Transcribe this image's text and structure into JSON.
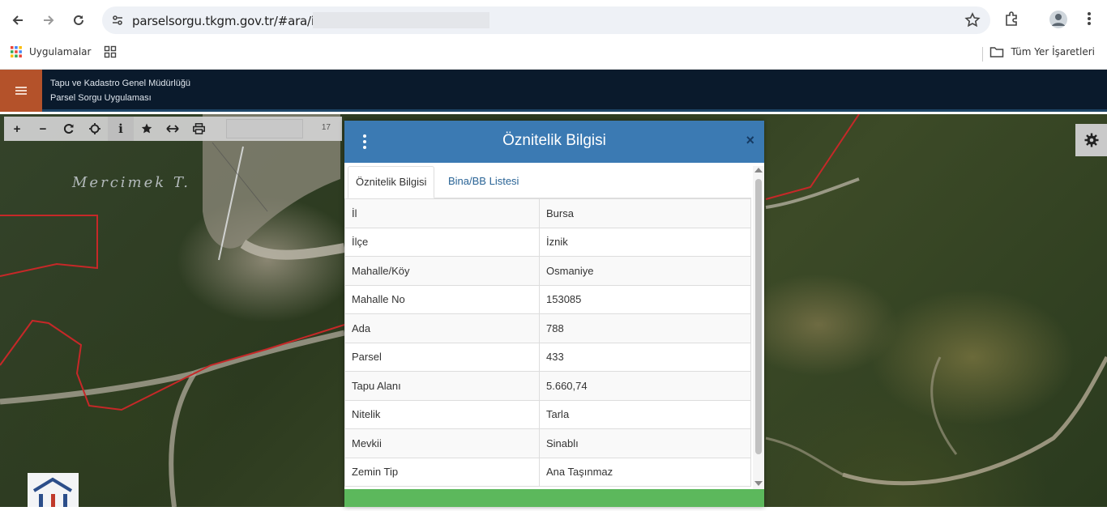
{
  "browser": {
    "url": "parselsorgu.tkgm.gov.tr/#ara/idari/",
    "bookmarks_apps_label": "Uygulamalar",
    "bookmarks_all_label": "Tüm Yer İşaretleri"
  },
  "app": {
    "org_title": "Tapu ve Kadastro Genel Müdürlüğü",
    "app_title": "Parsel Sorgu Uygulaması"
  },
  "toolbar": {
    "zoom_level": "17",
    "tools": [
      "zoom-in",
      "zoom-out",
      "refresh",
      "locate",
      "info",
      "favorite",
      "measure",
      "print"
    ]
  },
  "map": {
    "place_label": "Mercimek T."
  },
  "modal": {
    "title": "Öznitelik Bilgisi",
    "close_label": "×",
    "tabs": [
      {
        "label": "Öznitelik Bilgisi",
        "active": true
      },
      {
        "label": "Bina/BB Listesi",
        "active": false
      }
    ],
    "rows": [
      {
        "key": "İl",
        "value": "Bursa"
      },
      {
        "key": "İlçe",
        "value": "İznik"
      },
      {
        "key": "Mahalle/Köy",
        "value": "Osmaniye"
      },
      {
        "key": "Mahalle No",
        "value": "153085"
      },
      {
        "key": "Ada",
        "value": "788"
      },
      {
        "key": "Parsel",
        "value": "433"
      },
      {
        "key": "Tapu Alanı",
        "value": "5.660,74"
      },
      {
        "key": "Nitelik",
        "value": "Tarla"
      },
      {
        "key": "Mevkii",
        "value": "Sinablı"
      },
      {
        "key": "Zemin Tip",
        "value": "Ana Taşınmaz"
      }
    ]
  },
  "colors": {
    "modal_header": "#3b7ab3",
    "app_header": "#0a1a2c",
    "menu_button": "#b4522a",
    "modal_footer": "#5cb85c",
    "parcel_boundary": "#c62828"
  }
}
